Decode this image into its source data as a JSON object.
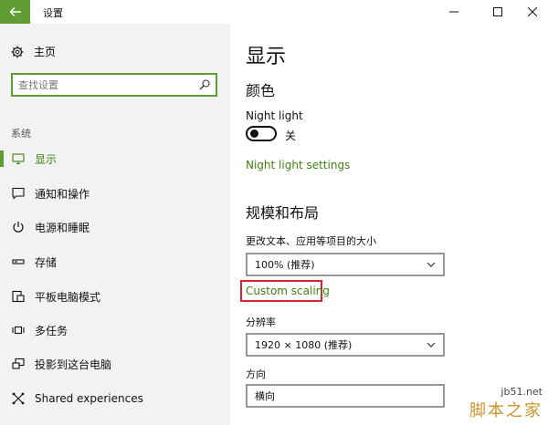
{
  "window": {
    "title": "设置",
    "accent_color": "#5f9c31"
  },
  "sidebar": {
    "home_label": "主页",
    "search_placeholder": "查找设置",
    "section_label": "系统",
    "items": [
      {
        "label": "显示",
        "icon": "monitor-icon",
        "active": true
      },
      {
        "label": "通知和操作",
        "icon": "notification-icon",
        "active": false
      },
      {
        "label": "电源和睡眠",
        "icon": "power-icon",
        "active": false
      },
      {
        "label": "存储",
        "icon": "storage-icon",
        "active": false
      },
      {
        "label": "平板电脑模式",
        "icon": "tablet-mode-icon",
        "active": false
      },
      {
        "label": "多任务",
        "icon": "multitasking-icon",
        "active": false
      },
      {
        "label": "投影到这台电脑",
        "icon": "project-icon",
        "active": false
      },
      {
        "label": "Shared experiences",
        "icon": "shared-experiences-icon",
        "active": false
      }
    ]
  },
  "main": {
    "page_title": "显示",
    "color_heading": "颜色",
    "night_light_label": "Night light",
    "night_light_state": "关",
    "night_light_on": false,
    "night_light_settings_link": "Night light settings",
    "scale_heading": "规模和布局",
    "change_size_label": "更改文本、应用等项目的大小",
    "scale_value": "100% (推荐)",
    "custom_scaling_link": "Custom scaling",
    "highlight_color": "#d9232e",
    "resolution_label": "分辨率",
    "resolution_value": "1920 × 1080 (推荐)",
    "orientation_label": "方向",
    "orientation_value": "横向"
  },
  "watermark": {
    "url": "jb51.net",
    "name": "脚本之家"
  }
}
